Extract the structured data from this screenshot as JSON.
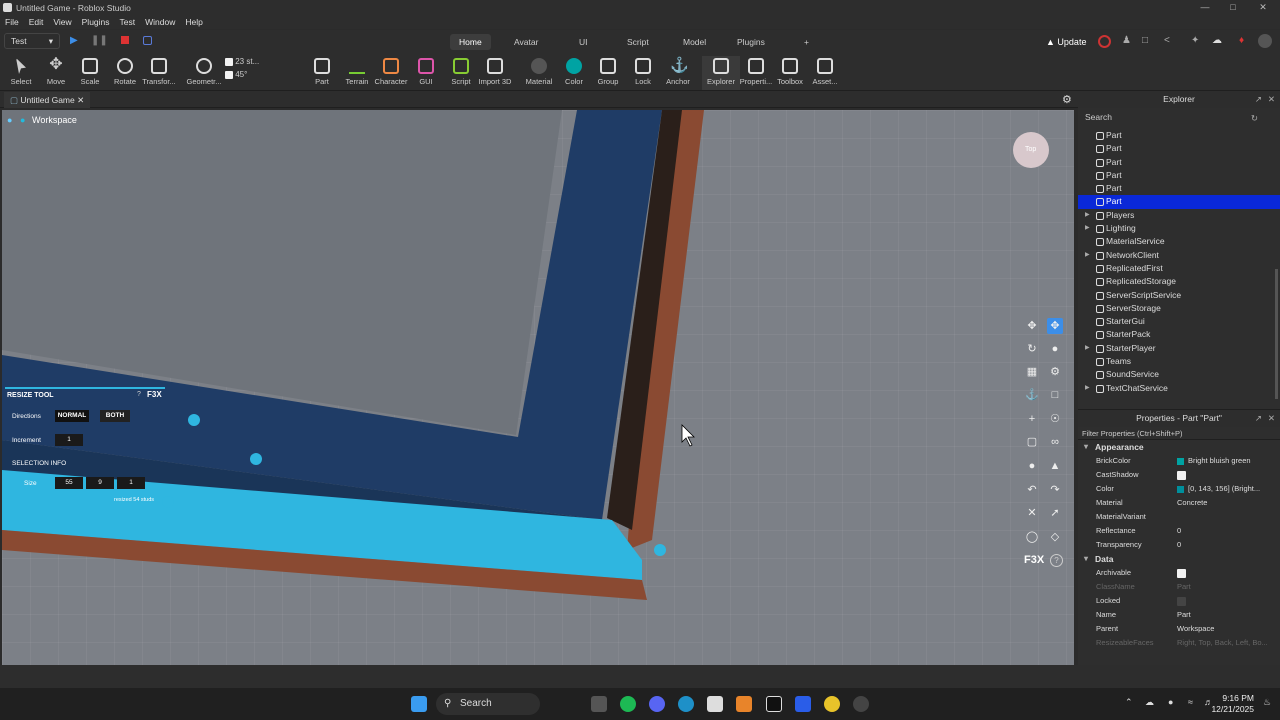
{
  "window": {
    "title": "Untitled Game - Roblox Studio"
  },
  "menu": [
    "File",
    "Edit",
    "View",
    "Plugins",
    "Test",
    "Window",
    "Help"
  ],
  "play_mode": "Test",
  "ribbon_tabs": [
    "Home",
    "Avatar",
    "UI",
    "Script",
    "Model",
    "Plugins"
  ],
  "ribbon_add_icon": "plus-icon",
  "update_label": "Update",
  "tools": [
    "Select",
    "Move",
    "Scale",
    "Rotate",
    "Transfor...",
    "Geometr...",
    "Part",
    "Terrain",
    "Character",
    "GUI",
    "Script",
    "Import 3D",
    "Material",
    "Color",
    "Group",
    "Lock",
    "Anchor",
    "Explorer",
    "Properti...",
    "Toolbox",
    "Asset..."
  ],
  "snap": {
    "move": "23 st...",
    "rotate": "45°"
  },
  "doc_tab": "Untitled Game",
  "viewport": {
    "workspace_label": "Workspace",
    "cube_label": "Top"
  },
  "resize_tool": {
    "title": "RESIZE TOOL",
    "help": "?",
    "brand": "F3X",
    "directions_label": "Directions",
    "normal": "NORMAL",
    "both": "BOTH",
    "increment_label": "Increment",
    "increment": "1",
    "selection_label": "SELECTION INFO",
    "size_label": "Size",
    "size": [
      "55",
      "9",
      "1"
    ],
    "note": "resized 54 studs"
  },
  "f3x_brand": "F3X",
  "f3x_help": "?",
  "explorer": {
    "title": "Explorer",
    "search": "Search",
    "items": [
      {
        "label": "Part",
        "icon": "part-icon",
        "selected": false,
        "expandable": false
      },
      {
        "label": "Part",
        "icon": "part-icon",
        "selected": false,
        "expandable": false
      },
      {
        "label": "Part",
        "icon": "part-icon",
        "selected": false,
        "expandable": false
      },
      {
        "label": "Part",
        "icon": "part-icon",
        "selected": false,
        "expandable": false
      },
      {
        "label": "Part",
        "icon": "part-icon",
        "selected": false,
        "expandable": false
      },
      {
        "label": "Part",
        "icon": "part-icon",
        "selected": true,
        "expandable": false
      },
      {
        "label": "Players",
        "icon": "players-icon",
        "selected": false,
        "expandable": true
      },
      {
        "label": "Lighting",
        "icon": "lighting-icon",
        "selected": false,
        "expandable": true
      },
      {
        "label": "MaterialService",
        "icon": "material-service-icon",
        "selected": false,
        "expandable": false
      },
      {
        "label": "NetworkClient",
        "icon": "network-icon",
        "selected": false,
        "expandable": true
      },
      {
        "label": "ReplicatedFirst",
        "icon": "folder-icon",
        "selected": false,
        "expandable": false
      },
      {
        "label": "ReplicatedStorage",
        "icon": "folder-icon",
        "selected": false,
        "expandable": false
      },
      {
        "label": "ServerScriptService",
        "icon": "script-service-icon",
        "selected": false,
        "expandable": false
      },
      {
        "label": "ServerStorage",
        "icon": "storage-icon",
        "selected": false,
        "expandable": false
      },
      {
        "label": "StarterGui",
        "icon": "folder-icon",
        "selected": false,
        "expandable": false
      },
      {
        "label": "StarterPack",
        "icon": "folder-icon",
        "selected": false,
        "expandable": false
      },
      {
        "label": "StarterPlayer",
        "icon": "folder-icon",
        "selected": false,
        "expandable": true
      },
      {
        "label": "Teams",
        "icon": "teams-icon",
        "selected": false,
        "expandable": false
      },
      {
        "label": "SoundService",
        "icon": "sound-icon",
        "selected": false,
        "expandable": false
      },
      {
        "label": "TextChatService",
        "icon": "chat-icon",
        "selected": false,
        "expandable": true
      }
    ]
  },
  "properties": {
    "title": "Properties - Part \"Part\"",
    "filter": "Filter Properties (Ctrl+Shift+P)",
    "appearance_label": "Appearance",
    "appearance": [
      {
        "name": "BrickColor",
        "value": "Bright bluish green",
        "swatch": "#00a3a3",
        "check": null
      },
      {
        "name": "CastShadow",
        "value": "",
        "swatch": null,
        "check": true
      },
      {
        "name": "Color",
        "value": "[0, 143, 156] (Bright...",
        "swatch": "#008f9c",
        "check": null
      },
      {
        "name": "Material",
        "value": "Concrete",
        "swatch": null,
        "check": null
      },
      {
        "name": "MaterialVariant",
        "value": "",
        "swatch": null,
        "check": null
      },
      {
        "name": "Reflectance",
        "value": "0",
        "swatch": null,
        "check": null
      },
      {
        "name": "Transparency",
        "value": "0",
        "swatch": null,
        "check": null
      }
    ],
    "data_label": "Data",
    "data": [
      {
        "name": "Archivable",
        "value": "",
        "check": true,
        "dim": false
      },
      {
        "name": "ClassName",
        "value": "Part",
        "check": null,
        "dim": true
      },
      {
        "name": "Locked",
        "value": "",
        "check": false,
        "dim": false
      },
      {
        "name": "Name",
        "value": "Part",
        "check": null,
        "dim": false
      },
      {
        "name": "Parent",
        "value": "Workspace",
        "check": null,
        "dim": false
      },
      {
        "name": "ResizeableFaces",
        "value": "Right, Top, Back, Left, Bo...",
        "check": null,
        "dim": true
      }
    ]
  },
  "taskbar": {
    "search": "Search",
    "time": "9:16 PM",
    "date": "12/21/2025"
  },
  "colors": {
    "selection": "#0a28d8",
    "accent": "#3c8ee8",
    "cyan": "#2fb6e0",
    "water": "#1f3c66",
    "brick": "#8a4a32"
  }
}
